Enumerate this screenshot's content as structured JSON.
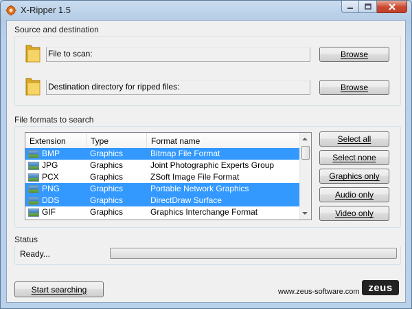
{
  "window": {
    "title": "X-Ripper 1.5"
  },
  "source_destination": {
    "group_label": "Source and destination",
    "file_label": "File to scan:",
    "file_value": "",
    "dest_label": "Destination directory for ripped files:",
    "dest_value": "",
    "browse_label": "Browse"
  },
  "formats": {
    "group_label": "File formats to search",
    "columns": [
      "Extension",
      "Type",
      "Format name"
    ],
    "rows": [
      {
        "ext": "BMP",
        "type": "Graphics",
        "name": "Bitmap File Format",
        "selected": true
      },
      {
        "ext": "JPG",
        "type": "Graphics",
        "name": "Joint Photographic Experts Group",
        "selected": false
      },
      {
        "ext": "PCX",
        "type": "Graphics",
        "name": "ZSoft Image File Format",
        "selected": false
      },
      {
        "ext": "PNG",
        "type": "Graphics",
        "name": "Portable Network Graphics",
        "selected": true
      },
      {
        "ext": "DDS",
        "type": "Graphics",
        "name": "DirectDraw Surface",
        "selected": true
      },
      {
        "ext": "GIF",
        "type": "Graphics",
        "name": "Graphics Interchange Format",
        "selected": false
      }
    ],
    "buttons": {
      "select_all": "Select all",
      "select_none": "Select none",
      "graphics_only": "Graphics only",
      "audio_only": "Audio only",
      "video_only": "Video only"
    }
  },
  "status": {
    "group_label": "Status",
    "text": "Ready...",
    "progress": 0
  },
  "footer": {
    "start_label": "Start searching",
    "url": "www.zeus-software.com",
    "logo": "zeus"
  },
  "colors": {
    "selection": "#3399ff",
    "frame": "#b9d1ea"
  },
  "icons": [
    "app-gear-icon",
    "minimize-icon",
    "maximize-icon",
    "close-icon",
    "folder-icon",
    "image-file-icon"
  ]
}
